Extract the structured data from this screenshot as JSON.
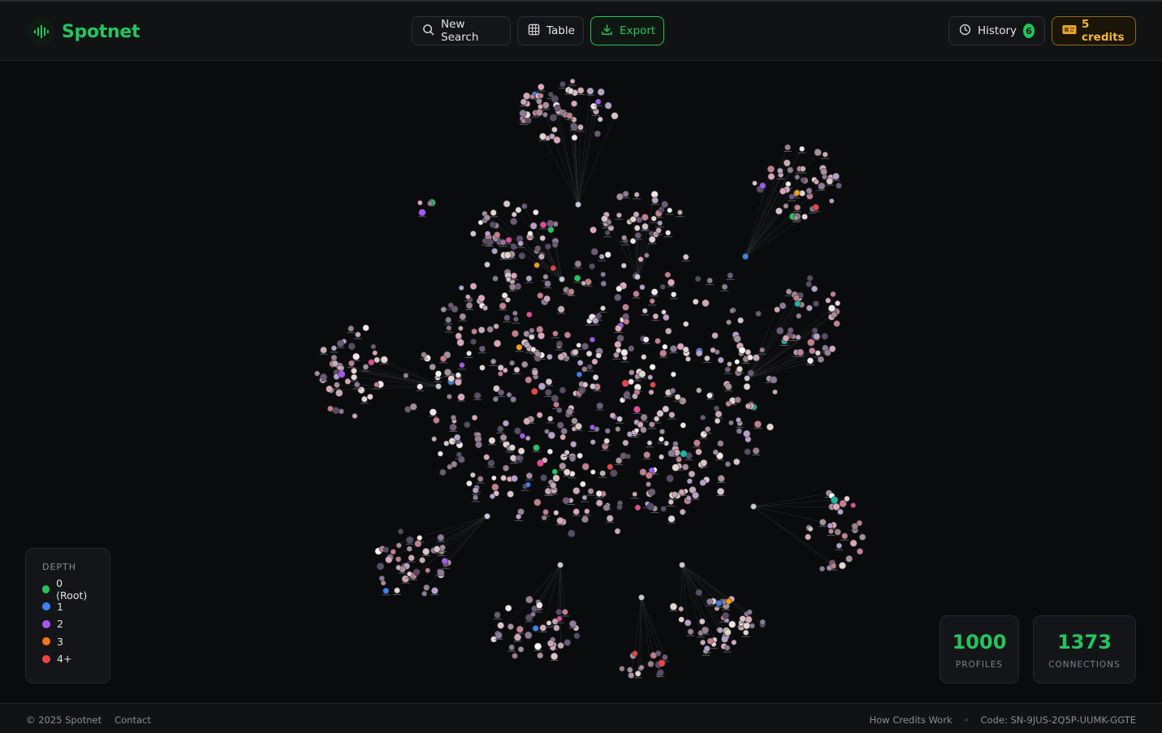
{
  "app": {
    "name": "Spotnet"
  },
  "toolbar": {
    "new_search": "New Search",
    "table": "Table",
    "export": "Export",
    "history": "History",
    "history_count": "6",
    "credits": "5 credits"
  },
  "legend": {
    "title": "DEPTH",
    "items": [
      {
        "label": "0 (Root)",
        "color": "#22c55e"
      },
      {
        "label": "1",
        "color": "#3b82f6"
      },
      {
        "label": "2",
        "color": "#a855f7"
      },
      {
        "label": "3",
        "color": "#f97316"
      },
      {
        "label": "4+",
        "color": "#ef4444"
      }
    ]
  },
  "stats": {
    "profiles": {
      "value": "1000",
      "label": "PROFILES"
    },
    "connections": {
      "value": "1373",
      "label": "CONNECTIONS"
    }
  },
  "footer": {
    "copyright": "© 2025 Spotnet",
    "contact": "Contact",
    "how_credits": "How Credits Work",
    "code": "Code: SN-9JUS-2Q5P-UUMK-GGTE"
  },
  "colors": {
    "accent": "#22c55e",
    "credits": "#f5b82e"
  }
}
